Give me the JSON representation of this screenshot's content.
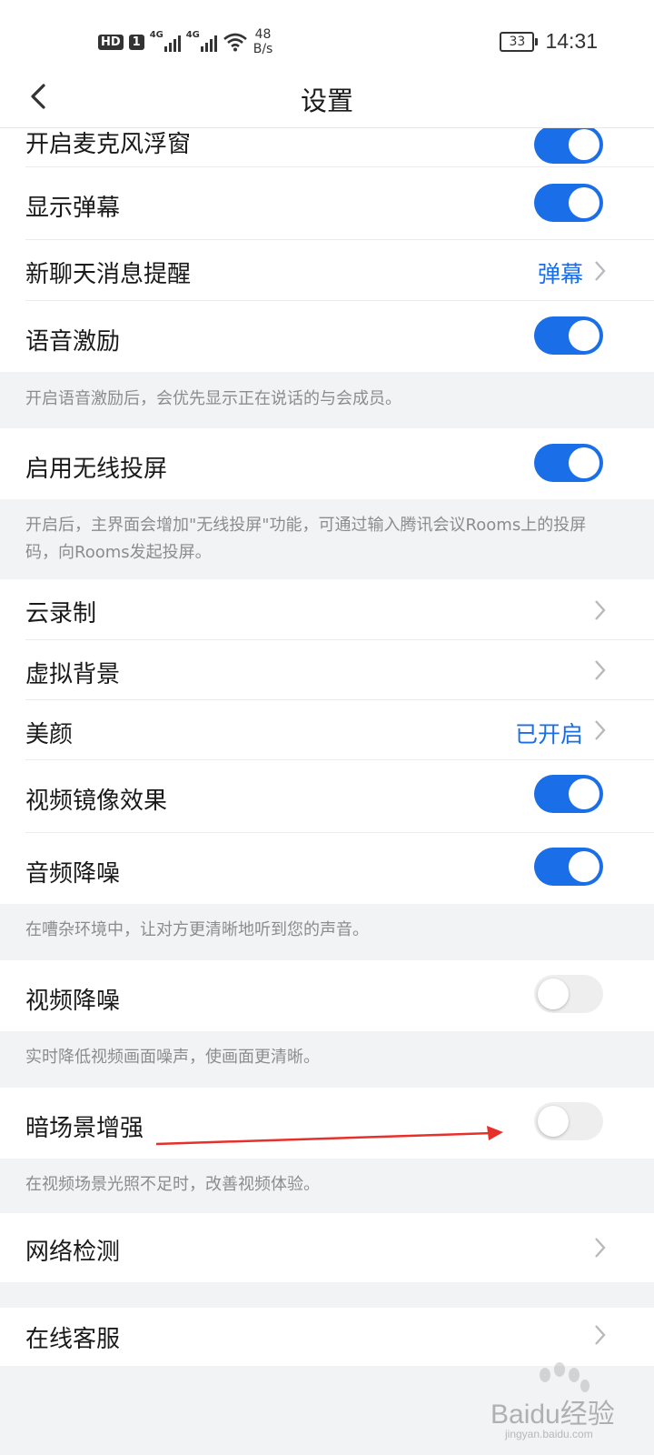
{
  "status_bar": {
    "hd": "HD",
    "sim": "1",
    "sig1": "4G",
    "sig2": "4G",
    "speed_value": "48",
    "speed_unit": "B/s",
    "battery": "33",
    "time": "14:31"
  },
  "nav": {
    "title": "设置"
  },
  "rows": {
    "mic_float": "开启麦克风浮窗",
    "show_danmaku": "显示弹幕",
    "new_chat_reminder": "新聊天消息提醒",
    "new_chat_reminder_value": "弹幕",
    "voice_excitation": "语音激励",
    "wireless_screen": "启用无线投屏",
    "cloud_record": "云录制",
    "virtual_bg": "虚拟背景",
    "beauty": "美颜",
    "beauty_value": "已开启",
    "video_mirror": "视频镜像效果",
    "audio_denoise": "音频降噪",
    "video_denoise": "视频降噪",
    "dark_enhance": "暗场景增强",
    "network_check": "网络检测",
    "online_service": "在线客服"
  },
  "notes": {
    "voice_excitation": "开启语音激励后，会优先显示正在说话的与会成员。",
    "wireless_screen": "开启后，主界面会增加\"无线投屏\"功能，可通过输入腾讯会议Rooms上的投屏码，向Rooms发起投屏。",
    "audio_denoise": "在嘈杂环境中，让对方更清晰地听到您的声音。",
    "video_denoise": "实时降低视频画面噪声，使画面更清晰。",
    "dark_enhance": "在视频场景光照不足时，改善视频体验。"
  },
  "toggles": {
    "mic_float": true,
    "show_danmaku": true,
    "voice_excitation": true,
    "wireless_screen": true,
    "video_mirror": true,
    "audio_denoise": true,
    "video_denoise": false,
    "dark_enhance": false
  },
  "watermark": {
    "brand": "Baidu经验",
    "site": "jingyan.baidu.com"
  },
  "colors": {
    "accent": "#1a6ee8",
    "annotation_arrow": "#e8302a"
  }
}
